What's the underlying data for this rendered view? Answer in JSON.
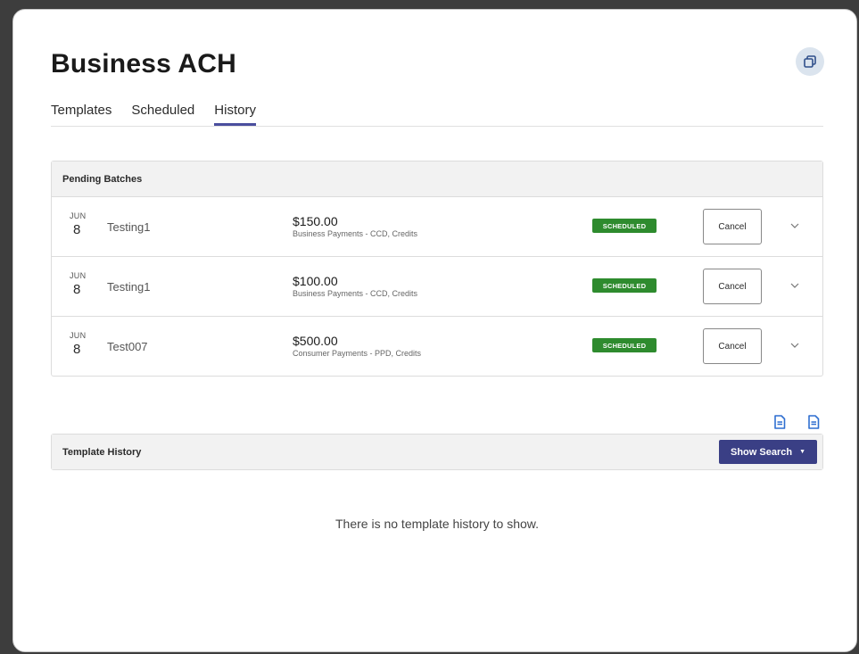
{
  "page": {
    "title": "Business ACH",
    "corner_icon": "copy-icon"
  },
  "tabs": [
    {
      "label": "Templates",
      "active": false
    },
    {
      "label": "Scheduled",
      "active": false
    },
    {
      "label": "History",
      "active": true
    }
  ],
  "pending_batches": {
    "header": "Pending Batches",
    "rows": [
      {
        "month": "JUN",
        "day": "8",
        "name": "Testing1",
        "amount": "$150.00",
        "description": "Business Payments - CCD, Credits",
        "status": "SCHEDULED",
        "action_label": "Cancel"
      },
      {
        "month": "JUN",
        "day": "8",
        "name": "Testing1",
        "amount": "$100.00",
        "description": "Business Payments - CCD, Credits",
        "status": "SCHEDULED",
        "action_label": "Cancel"
      },
      {
        "month": "JUN",
        "day": "8",
        "name": "Test007",
        "amount": "$500.00",
        "description": "Consumer Payments - PPD, Credits",
        "status": "SCHEDULED",
        "action_label": "Cancel"
      }
    ]
  },
  "export_icons": [
    "export-document-icon",
    "export-document-icon"
  ],
  "template_history": {
    "header": "Template History",
    "show_search_label": "Show Search",
    "empty_message": "There is no template history to show."
  },
  "colors": {
    "status_green": "#2e8b2e",
    "primary_button": "#3a3f85",
    "tab_underline": "#4a4e9e",
    "icon_blue": "#2f6fd0"
  }
}
